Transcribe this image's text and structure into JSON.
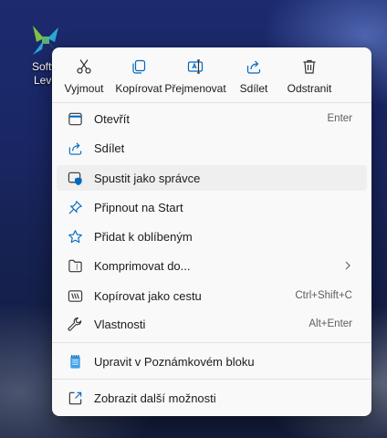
{
  "desktop": {
    "icon": {
      "label": "Softw\nLevn",
      "logo_colors": [
        "#7fc241",
        "#2aa7d9"
      ]
    }
  },
  "toolbar": [
    {
      "label": "Vyjmout",
      "icon": "scissors-icon"
    },
    {
      "label": "Kopírovat",
      "icon": "copy-icon"
    },
    {
      "label": "Přejmenovat",
      "icon": "rename-icon"
    },
    {
      "label": "Sdílet",
      "icon": "share-icon"
    },
    {
      "label": "Odstranit",
      "icon": "trash-icon"
    }
  ],
  "items": [
    {
      "label": "Otevřít",
      "shortcut": "Enter",
      "icon": "open-window-icon"
    },
    {
      "label": "Sdílet",
      "shortcut": "",
      "icon": "share-icon"
    },
    {
      "label": "Spustit jako správce",
      "shortcut": "",
      "icon": "shield-window-icon",
      "highlighted": true
    },
    {
      "label": "Připnout na Start",
      "shortcut": "",
      "icon": "pin-icon"
    },
    {
      "label": "Přidat k oblíbeným",
      "shortcut": "",
      "icon": "star-icon"
    },
    {
      "label": "Komprimovat do...",
      "shortcut": "",
      "icon": "folder-zip-icon",
      "submenu": true
    },
    {
      "label": "Kopírovat jako cestu",
      "shortcut": "Ctrl+Shift+C",
      "icon": "path-icon"
    },
    {
      "label": "Vlastnosti",
      "shortcut": "Alt+Enter",
      "icon": "wrench-icon"
    },
    {
      "label": "Upravit v Poznámkovém bloku",
      "shortcut": "",
      "icon": "notepad-icon"
    },
    {
      "label": "Zobrazit další možnosti",
      "shortcut": "",
      "icon": "more-options-icon"
    }
  ],
  "colors": {
    "accent": "#0067c0",
    "menu_bg": "#f9f9f9",
    "highlight": "#efefef"
  }
}
